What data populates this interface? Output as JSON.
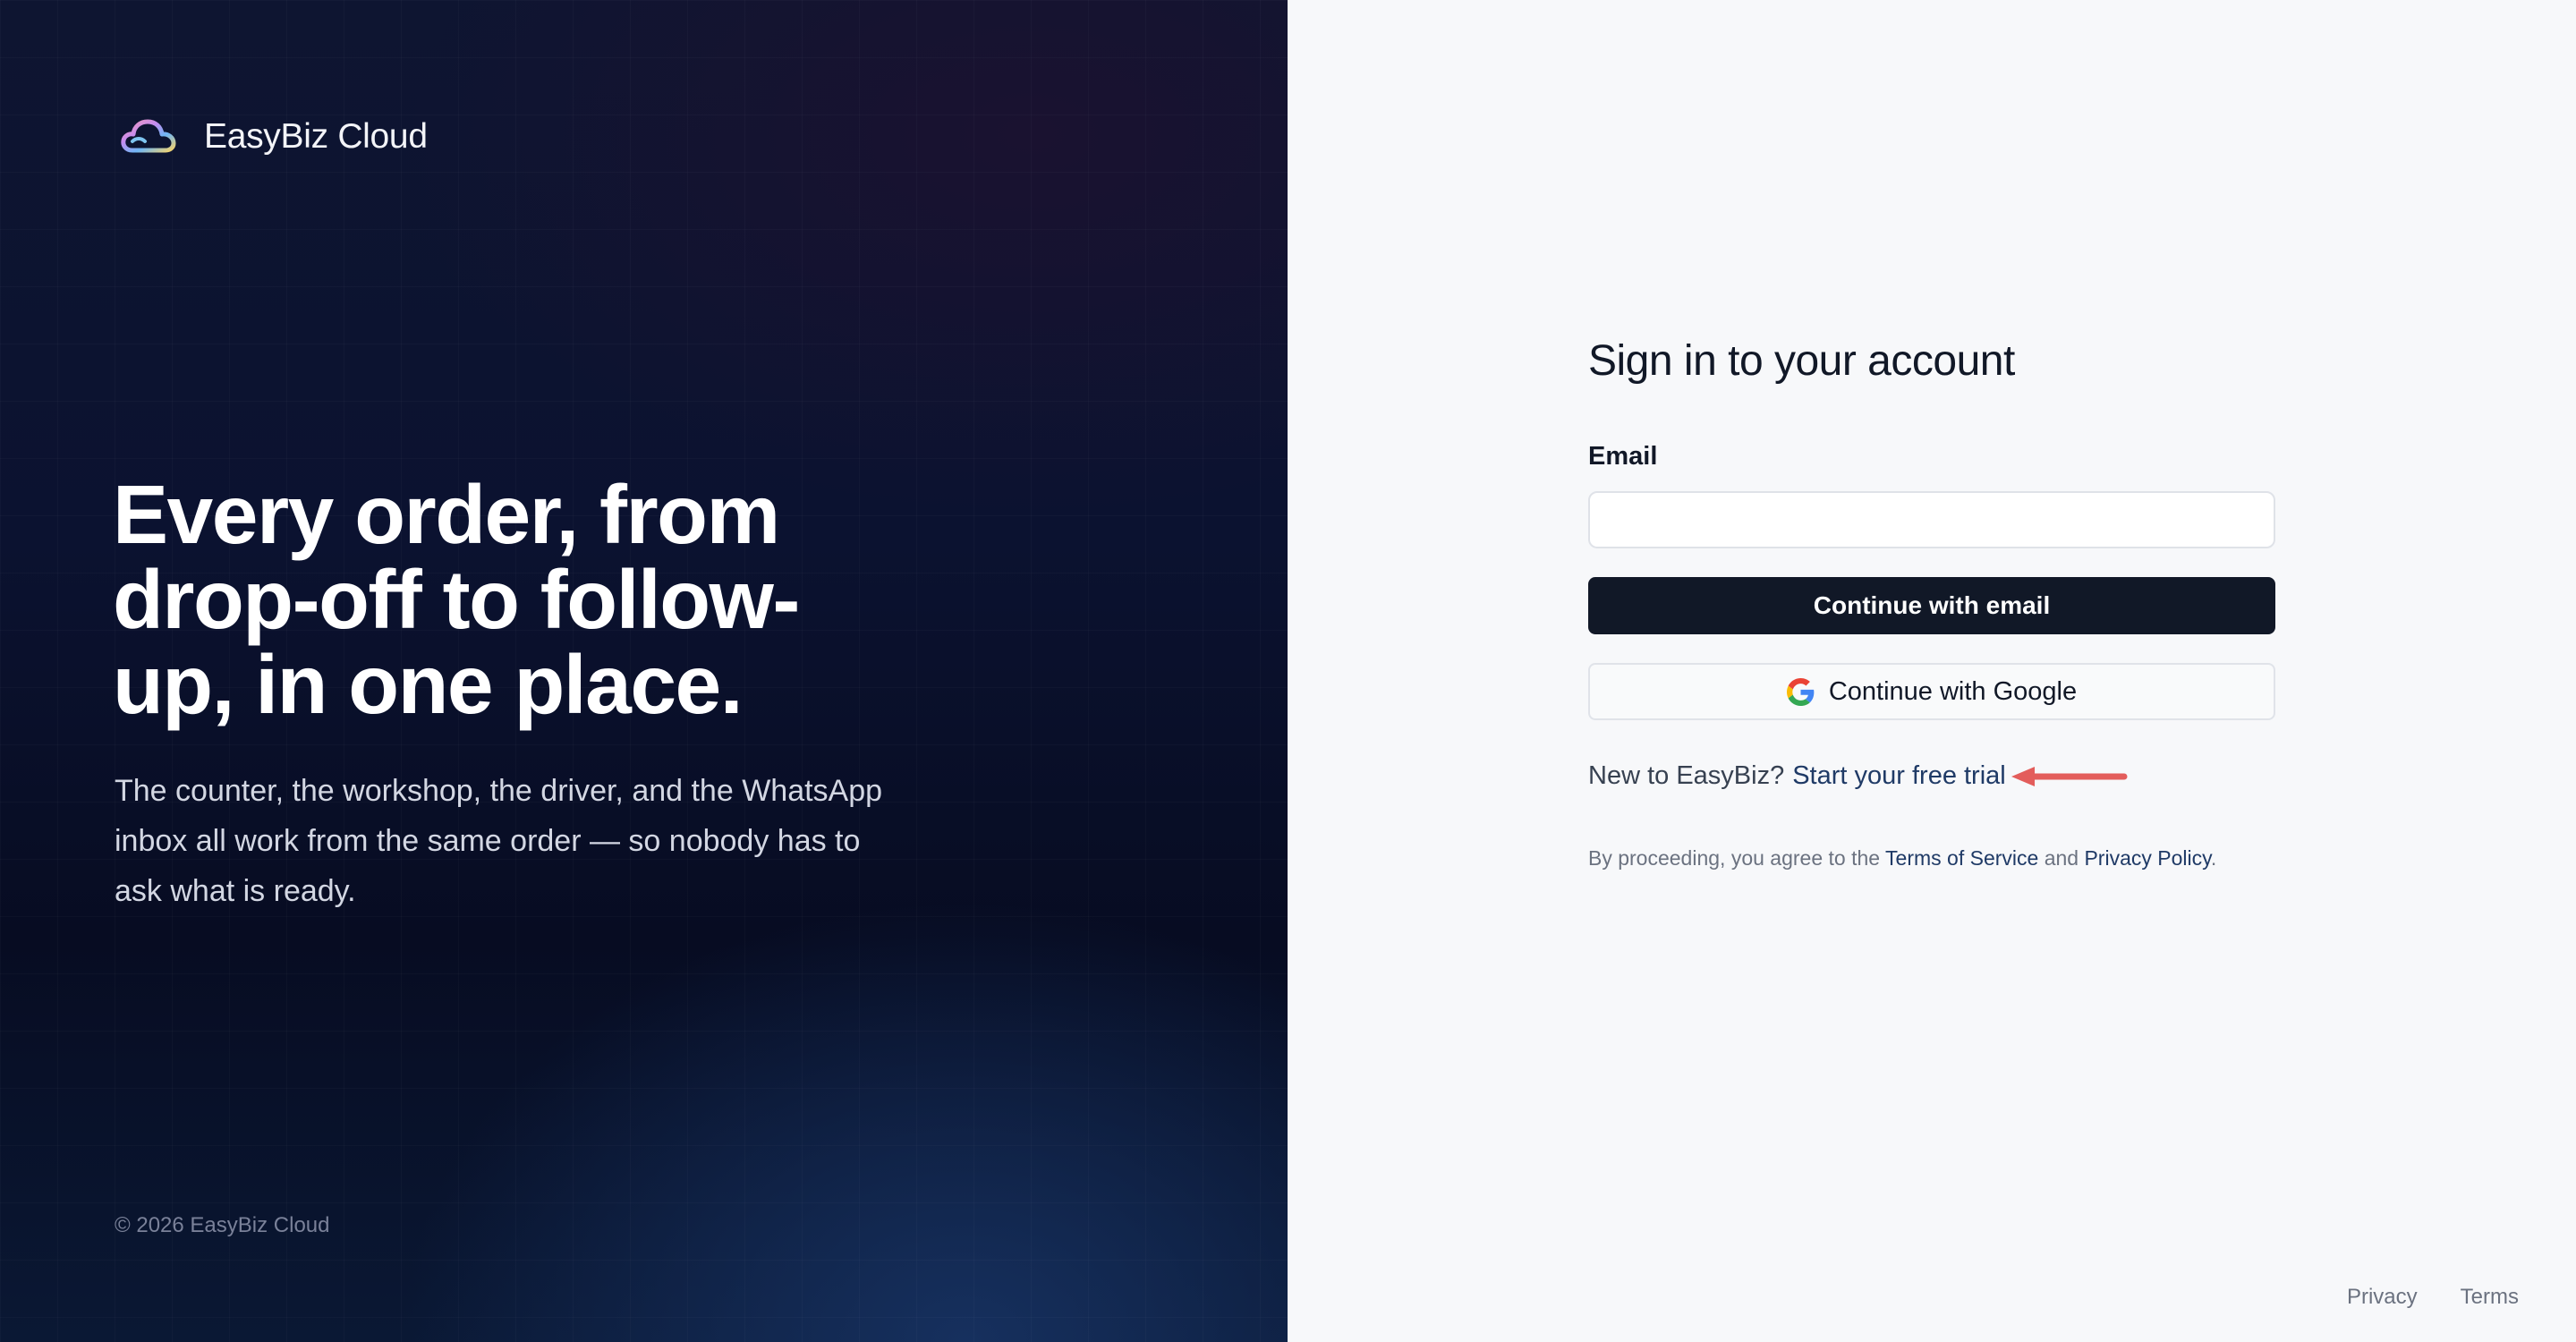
{
  "brand": {
    "name": "EasyBiz Cloud",
    "logo_icon": "cloud-icon"
  },
  "hero": {
    "title": "Every order, from drop-off to follow-up, in one place.",
    "subtitle": "The counter, the workshop, the driver, and the WhatsApp inbox all work from the same order — so nobody has to ask what is ready.",
    "copyright": "© 2026 EasyBiz Cloud"
  },
  "auth": {
    "title": "Sign in to your account",
    "email_label": "Email",
    "email_value": "",
    "email_placeholder": "",
    "continue_email_label": "Continue with email",
    "continue_google_label": "Continue with Google",
    "google_icon": "google-icon",
    "signup_prefix": "New to EasyBiz?",
    "signup_link": "Start your free trial",
    "legal_prefix": "By proceeding, you agree to the",
    "legal_terms": "Terms of Service",
    "legal_and": "and",
    "legal_privacy": "Privacy Policy",
    "legal_suffix": "."
  },
  "footer": {
    "privacy": "Privacy",
    "terms": "Terms"
  },
  "colors": {
    "hero_bg": "#0b1230",
    "primary_button": "#111827",
    "link": "#1f3a66",
    "annotation_arrow": "#e35d5b",
    "form_bg": "#f7f8fa"
  }
}
